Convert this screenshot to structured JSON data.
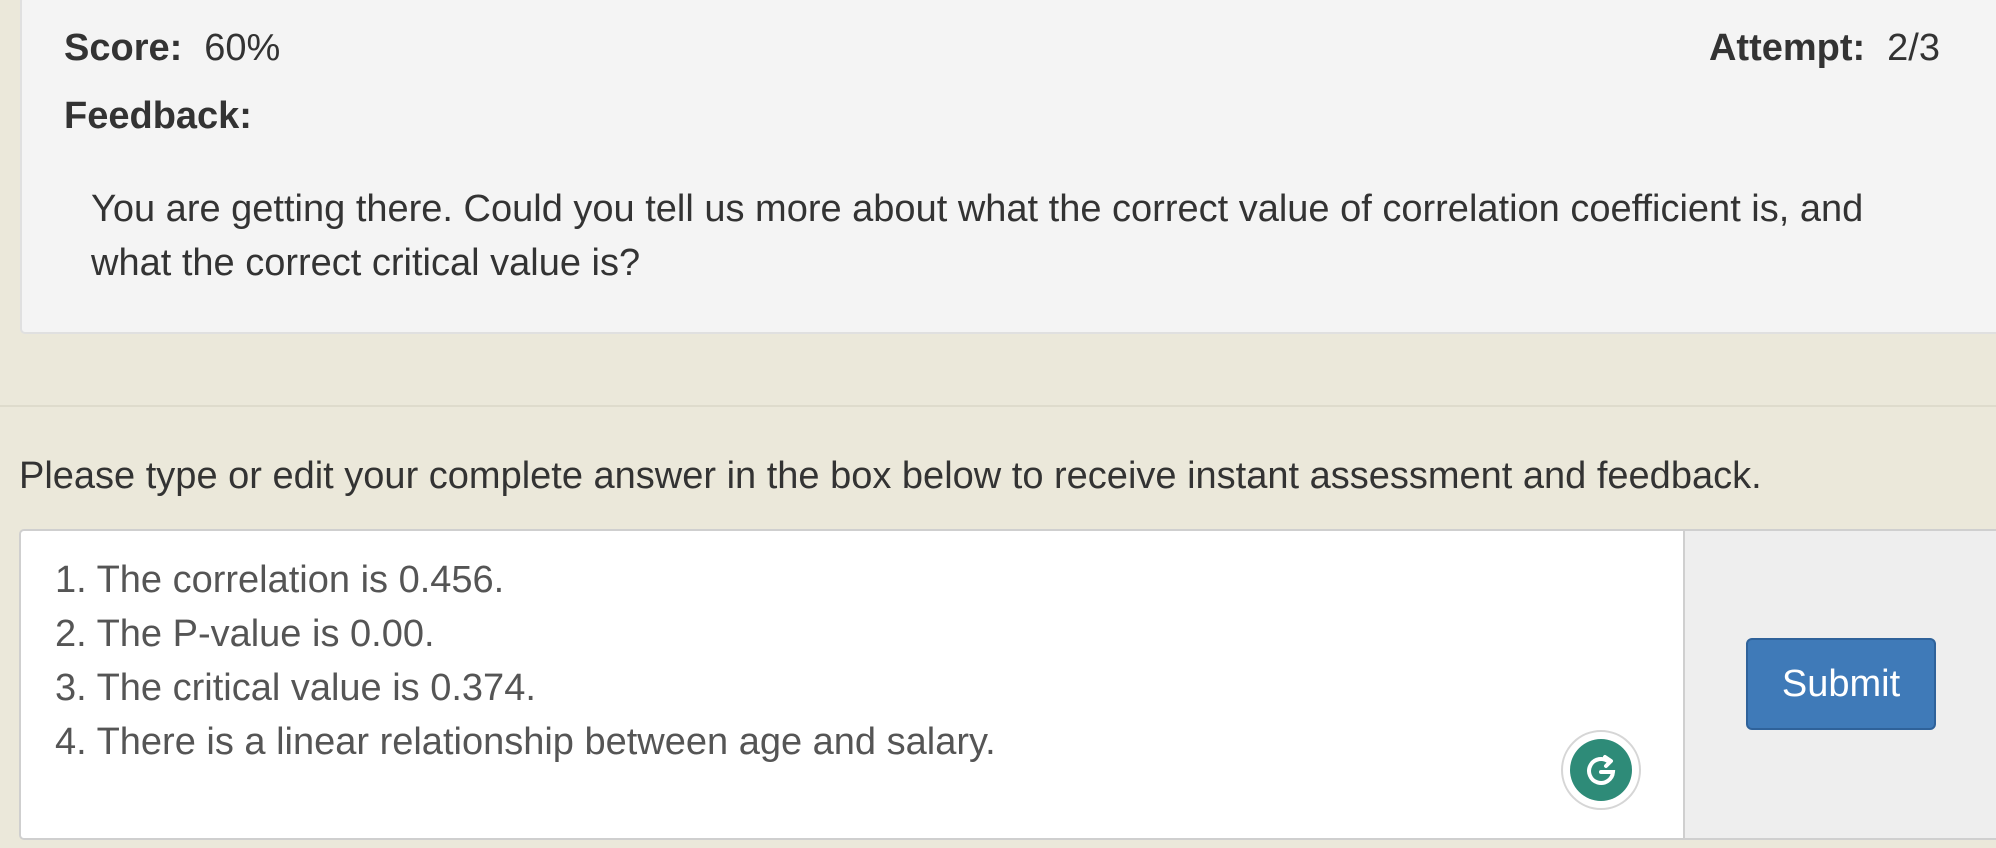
{
  "feedback_panel": {
    "score_label": "Score:",
    "score_value": "60%",
    "attempt_label": "Attempt:",
    "attempt_value": "2/3",
    "feedback_label": "Feedback:",
    "feedback_text": "You are getting there. Could you tell us more about what the correct value of correlation coefficient is, and what the correct critical value is?"
  },
  "instructions": "Please type or edit your complete answer in the box below to receive instant assessment and feedback.",
  "answer": {
    "lines": [
      "1. The correlation is 0.456.",
      "2. The P-value is 0.00.",
      "3. The critical value is 0.374.",
      "4. There is a linear relationship between age and salary."
    ],
    "grammarly_icon": "grammarly-g-icon"
  },
  "submit_label": "Submit",
  "colors": {
    "page_background": "#ebe8da",
    "panel_background": "#f4f4f4",
    "submit_button": "#3f7ab8",
    "grammarly_green": "#2e8b78"
  }
}
